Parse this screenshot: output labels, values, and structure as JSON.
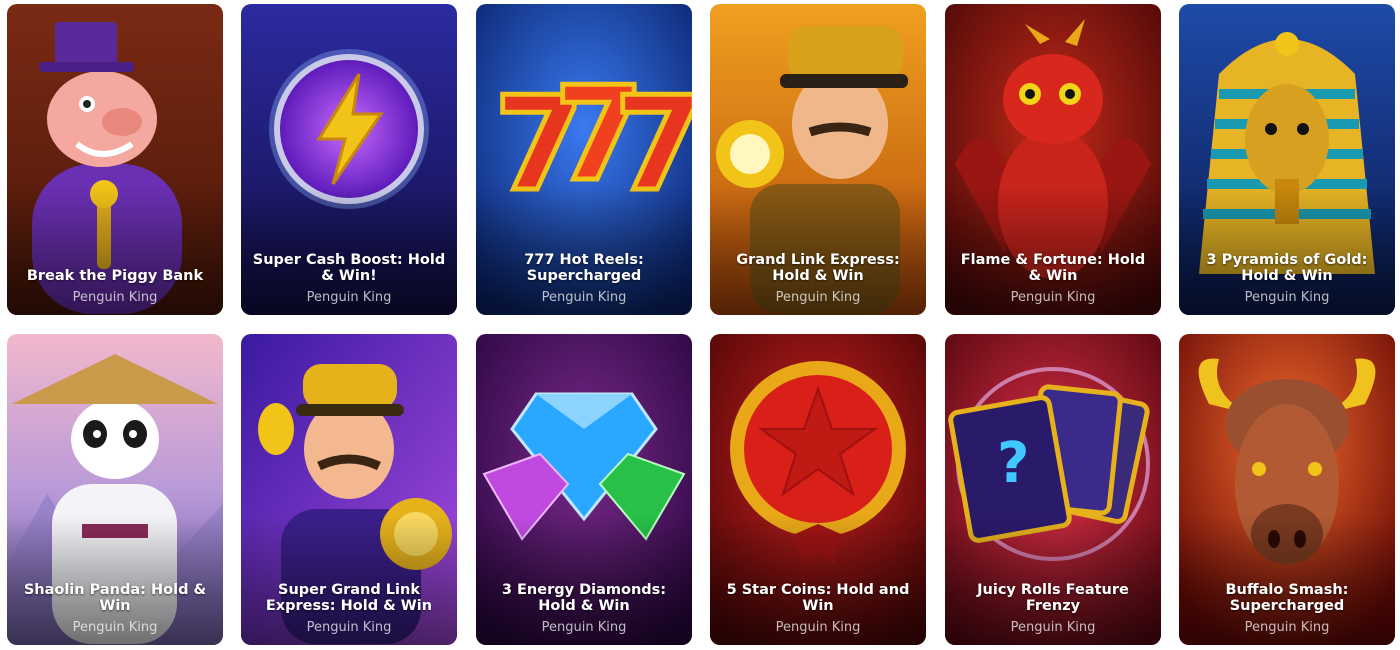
{
  "games": [
    {
      "title": "Break the Piggy Bank",
      "provider": "Penguin King"
    },
    {
      "title": "Super Cash Boost: Hold & Win!",
      "provider": "Penguin King"
    },
    {
      "title": "777 Hot Reels: Supercharged",
      "provider": "Penguin King"
    },
    {
      "title": "Grand Link Express: Hold & Win",
      "provider": "Penguin King"
    },
    {
      "title": "Flame & Fortune: Hold & Win",
      "provider": "Penguin King"
    },
    {
      "title": "3 Pyramids of Gold: Hold & Win",
      "provider": "Penguin King"
    },
    {
      "title": "Shaolin Panda: Hold & Win",
      "provider": "Penguin King"
    },
    {
      "title": "Super Grand Link Express: Hold & Win",
      "provider": "Penguin King"
    },
    {
      "title": "3 Energy Diamonds: Hold & Win",
      "provider": "Penguin King"
    },
    {
      "title": "5 Star Coins: Hold and Win",
      "provider": "Penguin King"
    },
    {
      "title": "Juicy Rolls Feature Frenzy",
      "provider": "Penguin King"
    },
    {
      "title": "Buffalo Smash: Supercharged",
      "provider": "Penguin King"
    }
  ],
  "art": [
    {
      "subject": "piggy-banker",
      "bg": [
        "#5a1f12",
        "#8a3018"
      ],
      "accent": "#6b2fb3"
    },
    {
      "subject": "lightning-orb",
      "bg": [
        "#1a1560",
        "#2c2aa0"
      ],
      "accent": "#f2c418"
    },
    {
      "subject": "triple-seven",
      "bg": [
        "#0a2a8a",
        "#1f55c8"
      ],
      "accent": "#e8351f"
    },
    {
      "subject": "train-conductor",
      "bg": [
        "#c25a0c",
        "#f0a020"
      ],
      "accent": "#d7a11a"
    },
    {
      "subject": "red-dragon",
      "bg": [
        "#5a0c0c",
        "#9a1e12"
      ],
      "accent": "#d8281e"
    },
    {
      "subject": "golden-pharaoh",
      "bg": [
        "#0d2a70",
        "#1e4aa8"
      ],
      "accent": "#e6b424"
    },
    {
      "subject": "shaolin-panda",
      "bg": [
        "#e9a8c8",
        "#9a7ad2"
      ],
      "accent": "#c89a4a"
    },
    {
      "subject": "grand-conductor",
      "bg": [
        "#3a1aa0",
        "#8a38d8"
      ],
      "accent": "#e6b21c"
    },
    {
      "subject": "energy-diamonds",
      "bg": [
        "#3a0a55",
        "#6a1a7a"
      ],
      "accent": "#2aa8ff"
    },
    {
      "subject": "star-coin",
      "bg": [
        "#6a0a0a",
        "#a01616"
      ],
      "accent": "#e8a818"
    },
    {
      "subject": "mystery-cards",
      "bg": [
        "#6a0a10",
        "#b3162a"
      ],
      "accent": "#9a3ad8"
    },
    {
      "subject": "buffalo",
      "bg": [
        "#7a0a08",
        "#c2261a"
      ],
      "accent": "#f0c21e"
    }
  ]
}
